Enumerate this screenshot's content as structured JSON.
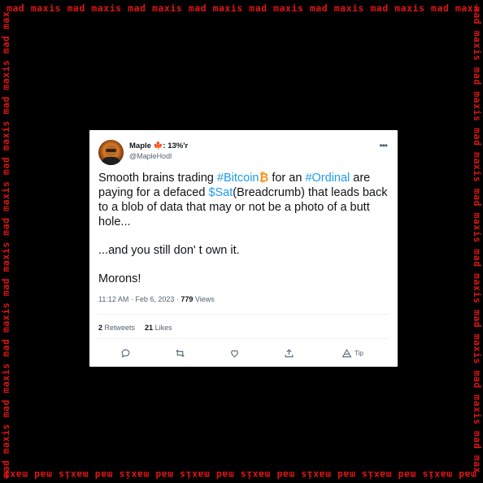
{
  "border": {
    "text": "mad maxis mad maxis mad maxis mad maxis mad maxis mad maxis mad maxis mad maxis",
    "color": "#e01414"
  },
  "tweet": {
    "author": {
      "name": "Maple 🍁: 13%'r",
      "handle": "@MapleHodl"
    },
    "body": {
      "p1_a": "Smooth brains trading ",
      "p1_tag1": "#Bitcoin",
      "p1_btc": "₿",
      "p1_b": "  for an ",
      "p1_tag2": "#Ordinal",
      "p1_c": " are paying for a defaced ",
      "p1_tag3": "$Sat",
      "p1_d": "(Breadcrumb) that leads back to a blob of data that may or not be a photo of a butt hole...",
      "p2": "...and you still don' t own it.",
      "p3": "Morons!"
    },
    "meta": {
      "time": "11:12 AM · Feb 6, 2023 · ",
      "views_count": "779",
      "views_label": " Views"
    },
    "stats": {
      "retweets_count": "2",
      "retweets_label": " Retweets",
      "likes_count": "21",
      "likes_label": " Likes"
    },
    "actions": {
      "tip_label": "Tip"
    },
    "colors": {
      "link": "#1d9bf0",
      "text": "#0f1419",
      "muted": "#536471"
    }
  }
}
